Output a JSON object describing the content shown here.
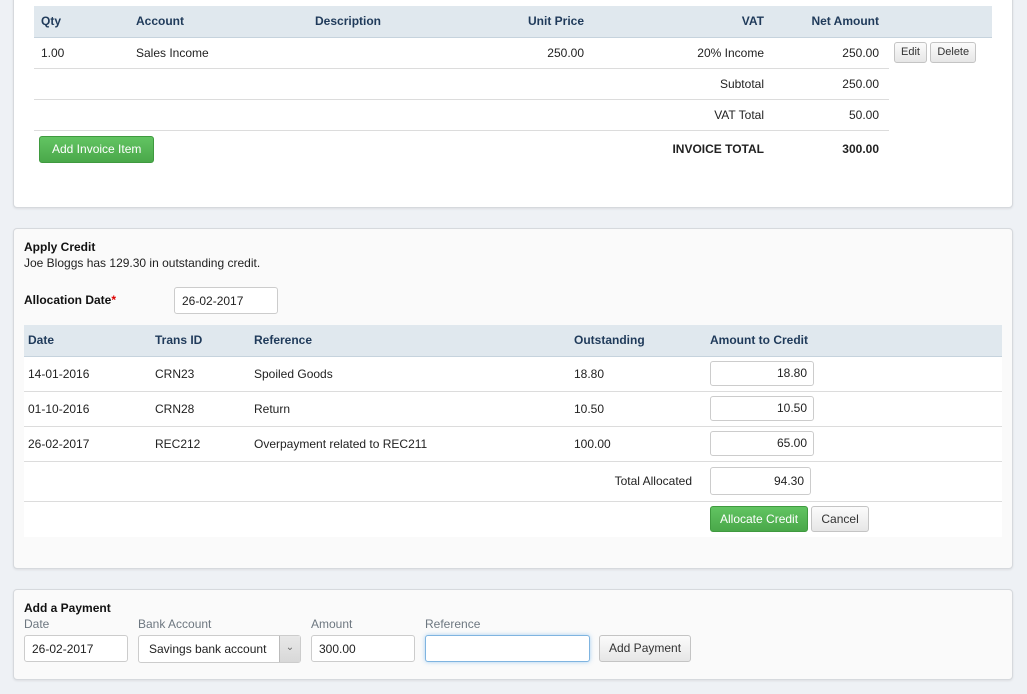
{
  "invoice": {
    "columns": [
      "Qty",
      "Account",
      "Description",
      "Unit Price",
      "VAT",
      "Net Amount"
    ],
    "items": [
      {
        "qty": "1.00",
        "account": "Sales Income",
        "description": "",
        "unit_price": "250.00",
        "vat": "20% Income",
        "net_amount": "250.00"
      }
    ],
    "edit_label": "Edit",
    "delete_label": "Delete",
    "subtotal_label": "Subtotal",
    "subtotal_value": "250.00",
    "vat_total_label": "VAT Total",
    "vat_total_value": "50.00",
    "invoice_total_label": "INVOICE TOTAL",
    "invoice_total_value": "300.00",
    "add_item_label": "Add Invoice Item"
  },
  "credit": {
    "title": "Apply Credit",
    "message": "Joe Bloggs has 129.30 in outstanding credit.",
    "allocation_date_label": "Allocation Date",
    "required_mark": "*",
    "allocation_date_value": "26-02-2017",
    "columns": [
      "Date",
      "Trans ID",
      "Reference",
      "Outstanding",
      "Amount to Credit"
    ],
    "rows": [
      {
        "date": "14-01-2016",
        "trans_id": "CRN23",
        "reference": "Spoiled Goods",
        "outstanding": "18.80",
        "amount": "18.80"
      },
      {
        "date": "01-10-2016",
        "trans_id": "CRN28",
        "reference": "Return",
        "outstanding": "10.50",
        "amount": "10.50"
      },
      {
        "date": "26-02-2017",
        "trans_id": "REC212",
        "reference": "Overpayment related to REC211",
        "outstanding": "100.00",
        "amount": "65.00"
      }
    ],
    "total_allocated_label": "Total Allocated",
    "total_allocated_value": "94.30",
    "allocate_label": "Allocate Credit",
    "cancel_label": "Cancel"
  },
  "payment": {
    "title": "Add a Payment",
    "date_label": "Date",
    "date_value": "26-02-2017",
    "bank_label": "Bank Account",
    "bank_value": "Savings bank account",
    "amount_label": "Amount",
    "amount_value": "300.00",
    "reference_label": "Reference",
    "reference_value": "",
    "add_payment_label": "Add Payment"
  }
}
